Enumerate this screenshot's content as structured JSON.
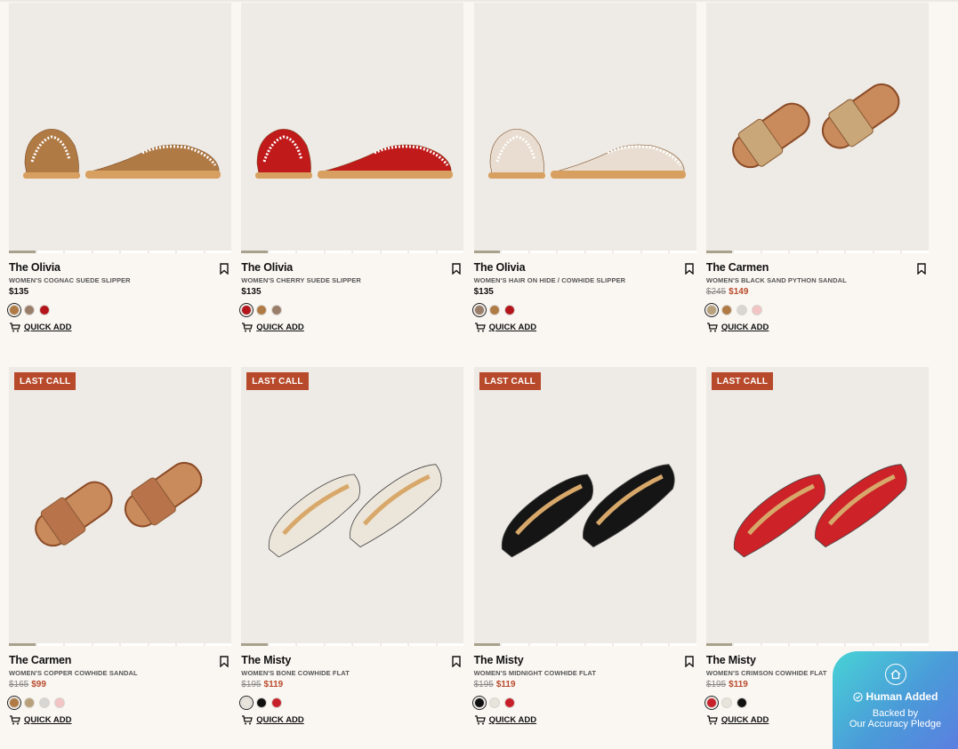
{
  "quick_add_label": "QUICK ADD",
  "products": [
    {
      "name": "The Olivia",
      "desc": "WOMEN'S COGNAC SUEDE SLIPPER",
      "price": "$135",
      "orig": "",
      "sale": "",
      "badge": "",
      "swatches": [
        "#b07a45",
        "#9a7e6a",
        "#b3151b"
      ],
      "selected": 0,
      "shoe": "slipper",
      "color": "#b07a45"
    },
    {
      "name": "The Olivia",
      "desc": "WOMEN'S CHERRY SUEDE SLIPPER",
      "price": "$135",
      "orig": "",
      "sale": "",
      "badge": "",
      "swatches": [
        "#b3151b",
        "#b07a45",
        "#9a7e6a"
      ],
      "selected": 0,
      "shoe": "slipper",
      "color": "#c01a1a"
    },
    {
      "name": "The Olivia",
      "desc": "WOMEN'S HAIR ON HIDE / COWHIDE SLIPPER",
      "price": "$135",
      "orig": "",
      "sale": "",
      "badge": "",
      "swatches": [
        "#9a7e6a",
        "#b07a45",
        "#b3151b"
      ],
      "selected": 0,
      "shoe": "slipper",
      "color": "#e8ddd0"
    },
    {
      "name": "The Carmen",
      "desc": "WOMEN'S BLACK SAND PYTHON SANDAL",
      "price": "",
      "orig": "$245",
      "sale": "$149",
      "badge": "",
      "swatches": [
        "#b8a07a",
        "#b07a45",
        "#d8d6d2",
        "#f2c4c4"
      ],
      "selected": 0,
      "shoe": "sandal",
      "color": "#c9a778"
    },
    {
      "name": "The Carmen",
      "desc": "WOMEN'S COPPER COWHIDE SANDAL",
      "price": "",
      "orig": "$165",
      "sale": "$99",
      "badge": "LAST CALL",
      "swatches": [
        "#b07a45",
        "#b8a07a",
        "#d8d6d2",
        "#f2c4c4"
      ],
      "selected": 0,
      "shoe": "sandal",
      "color": "#b8734a"
    },
    {
      "name": "The Misty",
      "desc": "WOMEN'S BONE COWHIDE FLAT",
      "price": "",
      "orig": "$195",
      "sale": "$119",
      "badge": "LAST CALL",
      "swatches": [
        "#e8e4dc",
        "#111111",
        "#c8202a"
      ],
      "selected": 0,
      "shoe": "flat",
      "color": "#ece6da"
    },
    {
      "name": "The Misty",
      "desc": "WOMEN'S MIDNIGHT COWHIDE FLAT",
      "price": "",
      "orig": "$195",
      "sale": "$119",
      "badge": "LAST CALL",
      "swatches": [
        "#111111",
        "#e8e4dc",
        "#c8202a"
      ],
      "selected": 0,
      "shoe": "flat",
      "color": "#151515"
    },
    {
      "name": "The Misty",
      "desc": "WOMEN'S CRIMSON COWHIDE FLAT",
      "price": "",
      "orig": "$195",
      "sale": "$119",
      "badge": "LAST CALL",
      "swatches": [
        "#c8202a",
        "#e8e4dc",
        "#111111"
      ],
      "selected": 0,
      "shoe": "flat",
      "color": "#cc2228"
    }
  ],
  "pledge": {
    "title": "Human Added",
    "line1": "Backed by",
    "line2": "Our Accuracy Pledge"
  }
}
